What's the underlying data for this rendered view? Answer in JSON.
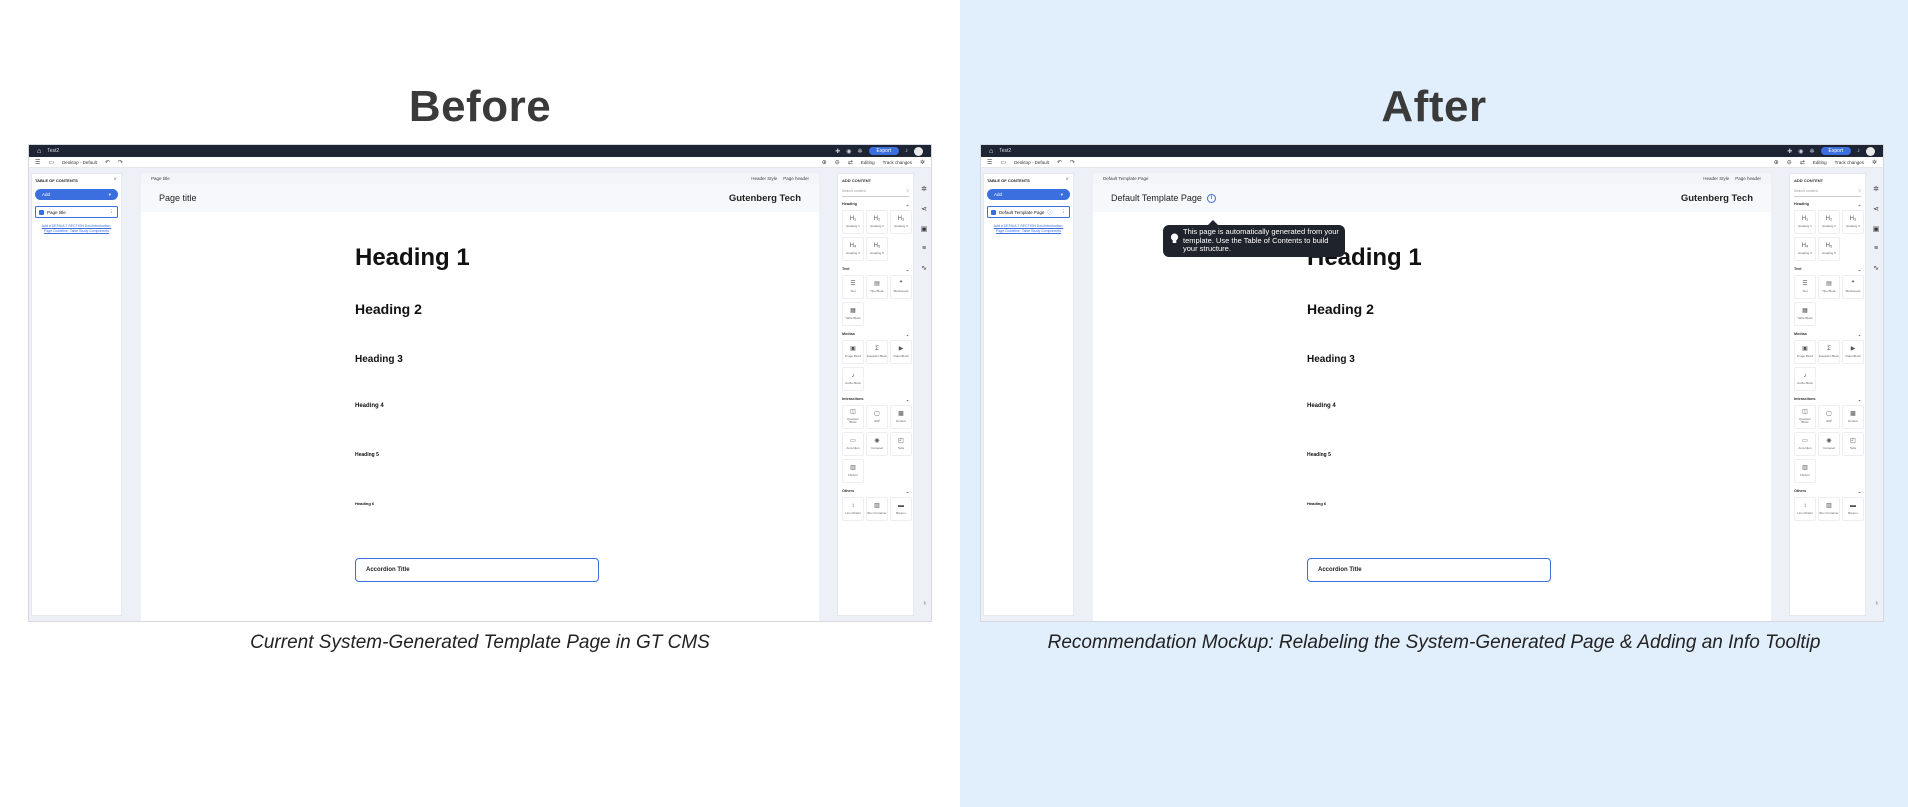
{
  "panels": [
    {
      "heading": "Before",
      "caption": "Current System-Generated Template Page in GT CMS",
      "app": {
        "doc_name": "Test2",
        "export_label": "Export",
        "device_label": "Desktop - Default",
        "mode_label": "Editing",
        "track_changes_label": "Track changes",
        "toc": {
          "title": "TABLE OF CONTENTS",
          "add_label": "Add",
          "item_label": "Page title",
          "help_text": "Add a DEFAULT SECTION Doc/Introduction, Page Guideline, Table Study Components"
        },
        "canvas": {
          "breadcrumb": "Page title",
          "header_style_label": "Header Style",
          "header_style_value": "Page header",
          "page_title": "Page title",
          "brand": "Gutenberg Tech",
          "headings": [
            "Heading 1",
            "Heading 2",
            "Heading 3",
            "Heading 4",
            "Heading 5",
            "Heading 6"
          ],
          "accordion_title": "Accordion Title"
        }
      }
    },
    {
      "heading": "After",
      "caption": "Recommendation Mockup: Relabeling the System-Generated Page & Adding an Info Tooltip",
      "app": {
        "doc_name": "Test2",
        "export_label": "Export",
        "device_label": "Desktop - Default",
        "mode_label": "Editing",
        "track_changes_label": "Track changes",
        "toc": {
          "title": "TABLE OF CONTENTS",
          "add_label": "Add",
          "item_label": "Default Template Page",
          "help_text": "Add a DEFAULT SECTION Doc/Introduction, Page Guideline, Table Study Components"
        },
        "canvas": {
          "breadcrumb": "Default Template Page",
          "header_style_label": "Header Style",
          "header_style_value": "Page header",
          "page_title": "Default Template Page",
          "brand": "Gutenberg Tech",
          "headings": [
            "Heading 1",
            "Heading 2",
            "Heading 3",
            "Heading 4",
            "Heading 5",
            "Heading 6"
          ],
          "accordion_title": "Accordion Title",
          "tooltip": "This page is automatically generated from your template. Use the Table of Contents to build your structure."
        }
      }
    }
  ],
  "add_content": {
    "title": "ADD CONTENT",
    "search_placeholder": "Search content",
    "sections": [
      {
        "name": "Heading",
        "blocks": [
          {
            "icon": "H₁",
            "label": "Heading 1"
          },
          {
            "icon": "H₂",
            "label": "Heading 2"
          },
          {
            "icon": "H₃",
            "label": "Heading 3"
          },
          {
            "icon": "H₄",
            "label": "Heading 4"
          },
          {
            "icon": "H₅",
            "label": "Heading 5"
          }
        ]
      },
      {
        "name": "Text",
        "blocks": [
          {
            "icon": "☰",
            "label": "Text"
          },
          {
            "icon": "▤",
            "label": "Tips Block"
          },
          {
            "icon": "❞",
            "label": "Blockquote"
          },
          {
            "icon": "▦",
            "label": "Table Block"
          }
        ]
      },
      {
        "name": "Medias",
        "blocks": [
          {
            "icon": "▣",
            "label": "Image Block"
          },
          {
            "icon": "Σ",
            "label": "Equation Block"
          },
          {
            "icon": "▶",
            "label": "Video Block"
          },
          {
            "icon": "♪",
            "label": "Audio Block"
          }
        ]
      },
      {
        "name": "Interactions",
        "blocks": [
          {
            "icon": "◫",
            "label": "Question Block"
          },
          {
            "icon": "▢",
            "label": "H5P"
          },
          {
            "icon": "▩",
            "label": "Embed"
          },
          {
            "icon": "▭",
            "label": "Accordion"
          },
          {
            "icon": "◉",
            "label": "Carousel"
          },
          {
            "icon": "◰",
            "label": "Tabs"
          },
          {
            "icon": "▥",
            "label": "Flipbox"
          }
        ]
      },
      {
        "name": "Others",
        "blocks": [
          {
            "icon": "↕",
            "label": "Line Divider"
          },
          {
            "icon": "▨",
            "label": "Box Container"
          },
          {
            "icon": "▬",
            "label": "Banner"
          }
        ]
      }
    ]
  }
}
